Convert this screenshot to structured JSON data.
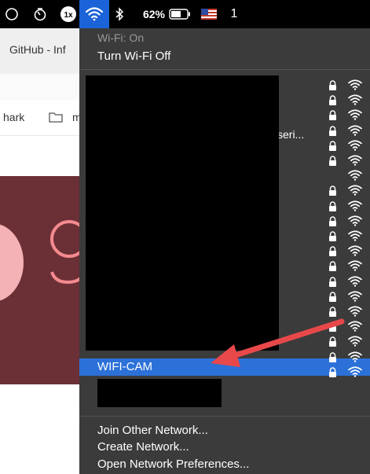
{
  "menubar": {
    "battery_percent": "62%",
    "partial_text": "1",
    "icons": [
      "moon-icon",
      "timer-icon",
      "speed-1x-icon",
      "wifi-icon",
      "bluetooth-icon",
      "battery-icon",
      "us-flag-icon"
    ],
    "speed_label": "1x"
  },
  "background_window": {
    "tab_label": "GitHub - Inf",
    "bookmark_label": "hark",
    "bookmark_folder_initial": "m"
  },
  "wifi_menu": {
    "status": "Wi-Fi: On",
    "toggle_label": "Turn Wi-Fi Off",
    "partial_network_label": "seri...",
    "networks": [
      {
        "name": "",
        "locked": true
      },
      {
        "name": "",
        "locked": true
      },
      {
        "name": "",
        "locked": true
      },
      {
        "name": "seri...",
        "locked": true
      },
      {
        "name": "",
        "locked": true
      },
      {
        "name": "",
        "locked": true
      },
      {
        "name": "",
        "locked": false
      },
      {
        "name": "",
        "locked": true
      },
      {
        "name": "",
        "locked": true
      },
      {
        "name": "",
        "locked": true
      },
      {
        "name": "",
        "locked": true
      },
      {
        "name": "",
        "locked": true
      },
      {
        "name": "",
        "locked": true
      },
      {
        "name": "",
        "locked": true
      },
      {
        "name": "",
        "locked": true
      },
      {
        "name": "",
        "locked": true
      },
      {
        "name": "",
        "locked": true
      },
      {
        "name": "WIFI-CAM",
        "locked": true,
        "selected": true
      },
      {
        "name": "",
        "locked": true
      },
      {
        "name": "",
        "locked": true
      }
    ],
    "selected_network": "WIFI-CAM",
    "footer": {
      "join_other": "Join Other Network...",
      "create": "Create Network...",
      "open_prefs": "Open Network Preferences..."
    }
  },
  "colors": {
    "menu_bg": "#3b3b3b",
    "selected_row": "#2c71d8",
    "annotation_arrow": "#e8484a",
    "menubar_bg": "#000000",
    "hero_bg": "#6b3036"
  }
}
